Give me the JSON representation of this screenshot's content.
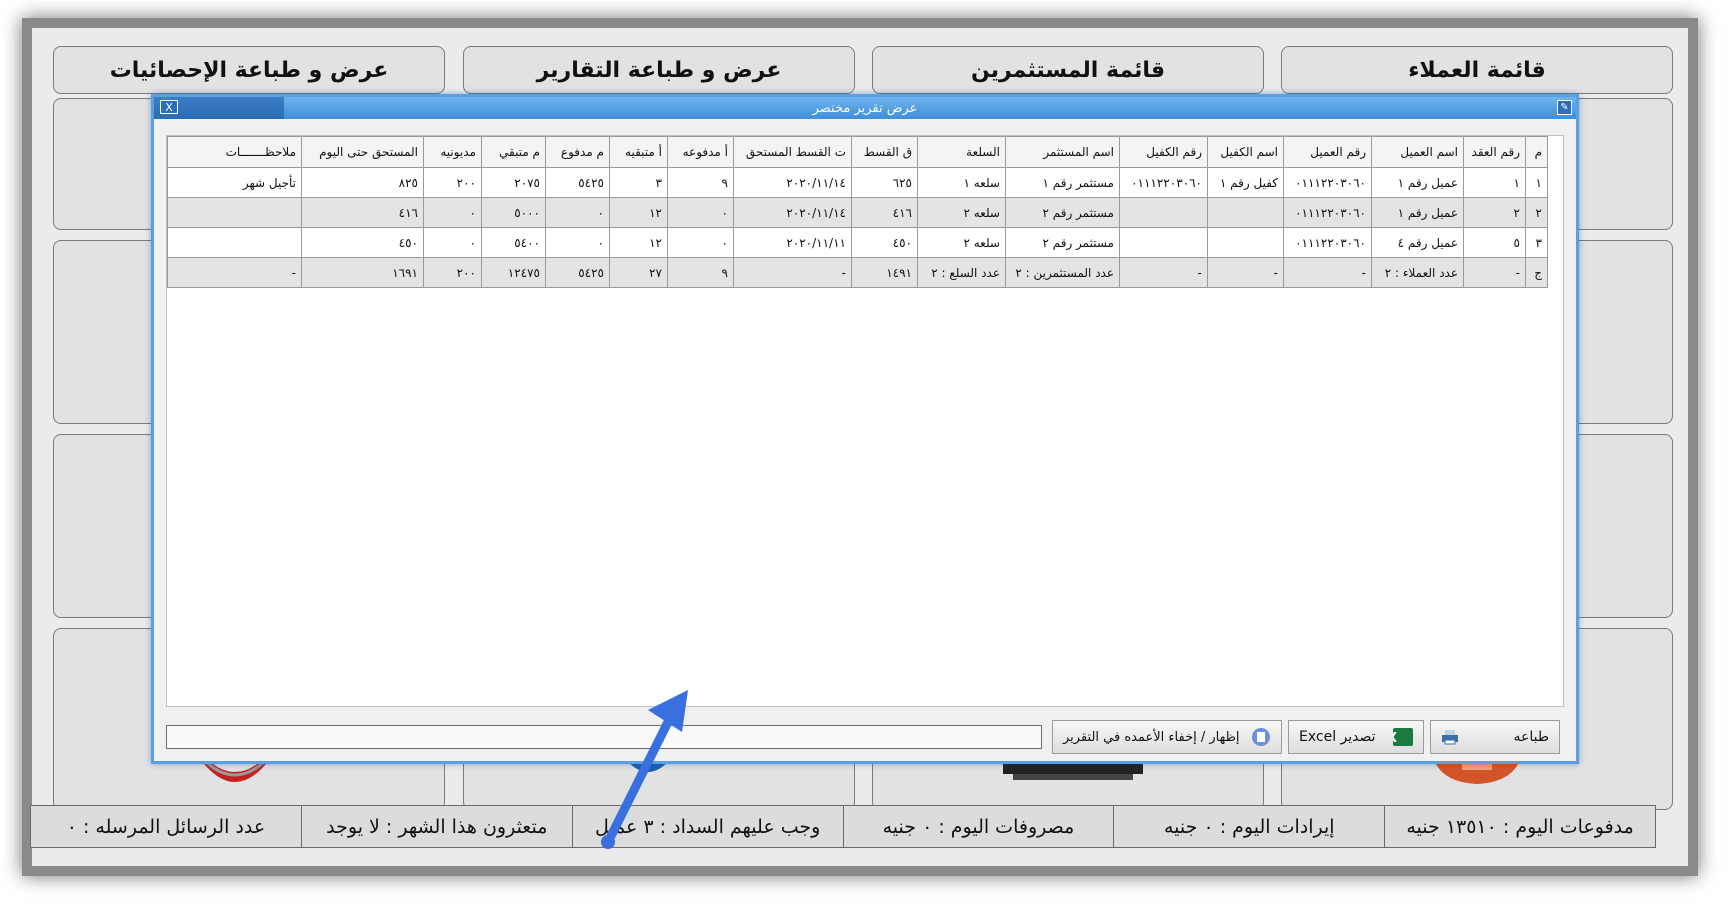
{
  "top_buttons": [
    "قائمة العملاء",
    "قائمة المستثمرين",
    "عرض و طباعة التقارير",
    "عرض و طباعة الإحصائيات"
  ],
  "status_bar": [
    "مدفوعات اليوم : ١٣٥١٠ جنيه",
    "إيرادات اليوم : ٠ جنيه",
    "مصروفات اليوم : ٠ جنيه",
    "وجب عليهم السداد : ٣ عميل",
    "متعثرون هذا الشهر : لا يوجد",
    "عدد الرسائل المرسله : ٠"
  ],
  "dialog": {
    "title": "عرض تقرير مختصر",
    "close_label": "X",
    "columns": [
      "م",
      "رقم العقد",
      "اسم العميل",
      "رقم العميل",
      "اسم الكفيل",
      "رقم الكفيل",
      "اسم المستثمر",
      "السلعة",
      "ق القسط",
      "ت القسط المستحق",
      "أ مدفوعه",
      "أ متبقيه",
      "م مدفوع",
      "م متبقي",
      "مديونيه",
      "المستحق حتى اليوم",
      "ملاحظـــــــات"
    ],
    "rows": [
      [
        "١",
        "١",
        "عميل رقم ١",
        "٠١١١٢٢٠٣٠٦٠",
        "كفيل رقم ١",
        "٠١١١٢٢٠٣٠٦٠",
        "مستثمر رقم ١",
        "سلعه ١",
        "٦٢٥",
        "٢٠٢٠/١١/١٤",
        "٩",
        "٣",
        "٥٤٢٥",
        "٢٠٧٥",
        "٢٠٠",
        "٨٢٥",
        "تأجيل شهر"
      ],
      [
        "٢",
        "٢",
        "عميل رقم ١",
        "٠١١١٢٢٠٣٠٦٠",
        "",
        "",
        "مستثمر رقم ٢",
        "سلعه ٢",
        "٤١٦",
        "٢٠٢٠/١١/١٤",
        "٠",
        "١٢",
        "٠",
        "٥٠٠٠",
        "٠",
        "٤١٦",
        ""
      ],
      [
        "٣",
        "٥",
        "عميل رقم ٤",
        "٠١١١٢٢٠٣٠٦٠",
        "",
        "",
        "مستثمر رقم ٢",
        "سلعه ٢",
        "٤٥٠",
        "٢٠٢٠/١١/١١",
        "٠",
        "١٢",
        "٠",
        "٥٤٠٠",
        "٠",
        "٤٥٠",
        ""
      ],
      [
        "ج",
        "-",
        "عدد العملاء : ٢",
        "-",
        "-",
        "-",
        "عدد المستثمرين : ٢",
        "عدد السلع : ٢",
        "١٤٩١",
        "-",
        "٩",
        "٢٧",
        "٥٤٢٥",
        "١٢٤٧٥",
        "٢٠٠",
        "١٦٩١",
        "-"
      ]
    ],
    "buttons": {
      "print": "طباعه",
      "export_excel": "تصدير Excel",
      "toggle_columns": "إظهار / إخفاء الأعمده في التقرير"
    }
  },
  "colors": {
    "accent": "#3f8ed8",
    "annotation_arrow": "#3a6fe0"
  }
}
